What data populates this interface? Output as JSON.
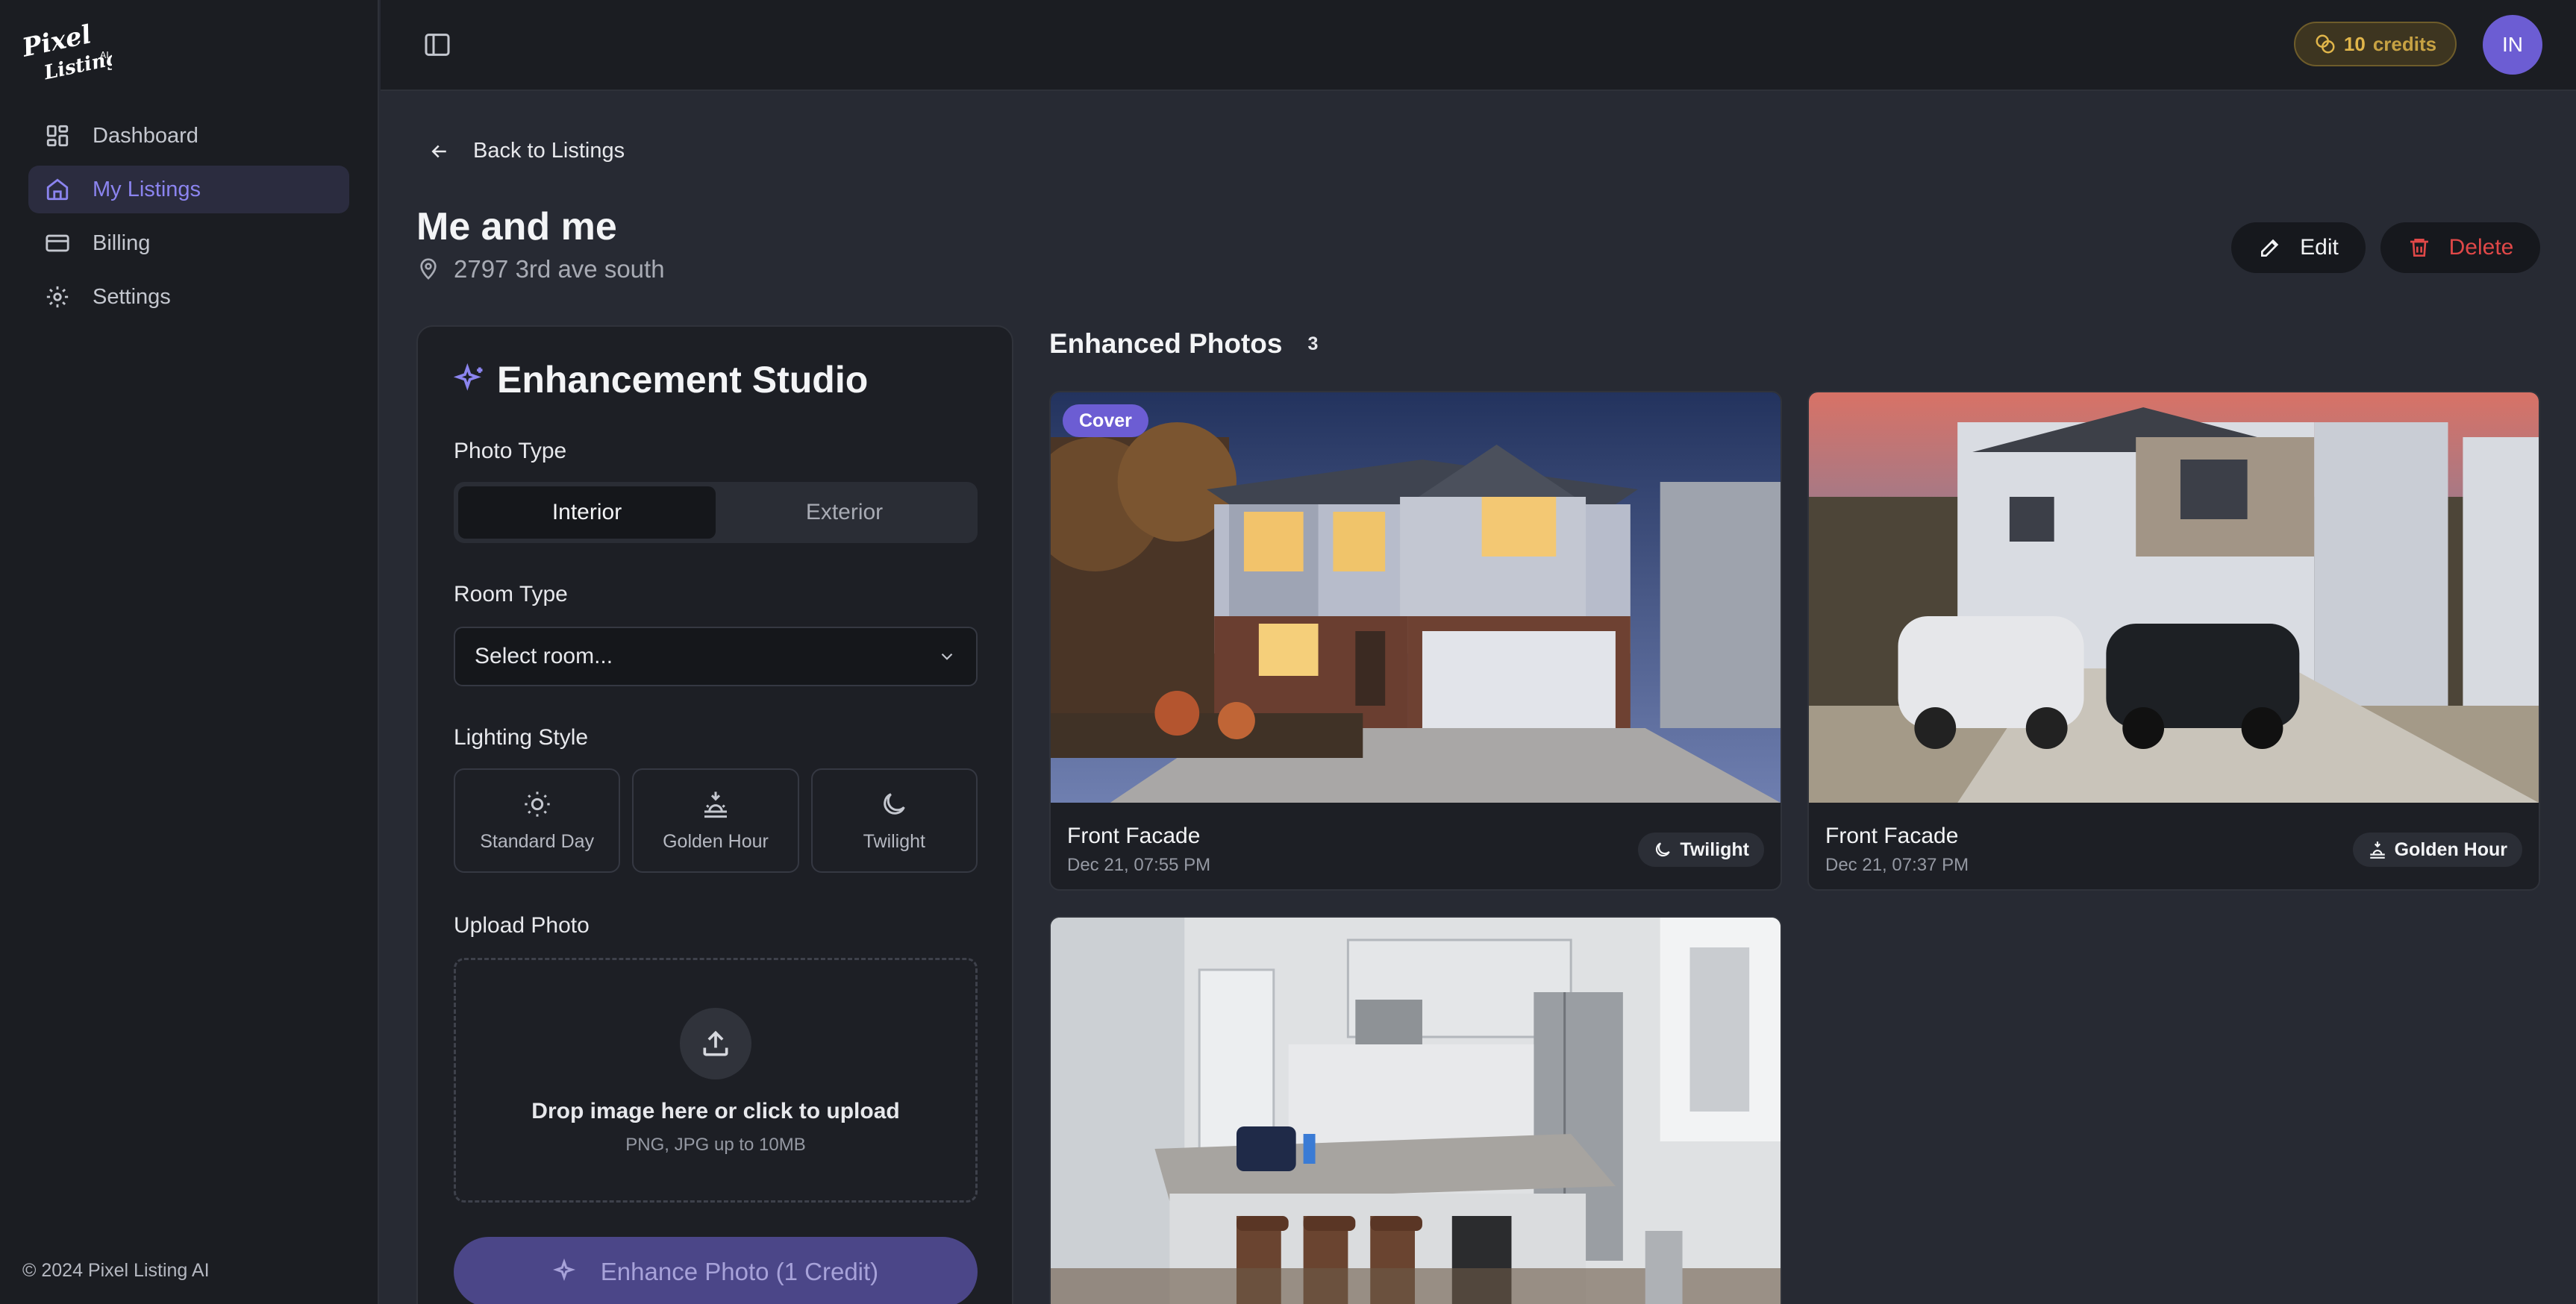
{
  "app": {
    "logo_text": "Pixel Listing AI",
    "copyright": "© 2024 Pixel Listing AI"
  },
  "sidebar": {
    "items": [
      {
        "label": "Dashboard",
        "icon": "dashboard-icon",
        "active": false
      },
      {
        "label": "My Listings",
        "icon": "home-icon",
        "active": true
      },
      {
        "label": "Billing",
        "icon": "credit-card-icon",
        "active": false
      },
      {
        "label": "Settings",
        "icon": "gear-icon",
        "active": false
      }
    ]
  },
  "header": {
    "credits_count": "10",
    "credits_label": "credits",
    "avatar_initials": "IN"
  },
  "listing": {
    "back_label": "Back to Listings",
    "title": "Me and me",
    "address": "2797 3rd ave south",
    "edit_label": "Edit",
    "delete_label": "Delete"
  },
  "studio": {
    "title": "Enhancement Studio",
    "photo_type_label": "Photo Type",
    "photo_types": [
      "Interior",
      "Exterior"
    ],
    "selected_photo_type": "Interior",
    "room_type_label": "Room Type",
    "room_select_value": "Select room...",
    "lighting_label": "Lighting Style",
    "lighting_options": [
      "Standard Day",
      "Golden Hour",
      "Twilight"
    ],
    "upload_label": "Upload Photo",
    "upload_main": "Drop image here or click to upload",
    "upload_sub": "PNG, JPG up to 10MB",
    "enhance_button": "Enhance Photo (1 Credit)"
  },
  "gallery": {
    "title": "Enhanced Photos",
    "count": "3",
    "photos": [
      {
        "badge": "Cover",
        "title": "Front Facade",
        "date": "Dec 21, 07:55 PM",
        "tag": "Twilight"
      },
      {
        "title": "Front Facade",
        "date": "Dec 21, 07:37 PM",
        "tag": "Golden Hour"
      },
      {
        "title": "",
        "date": "",
        "tag": ""
      }
    ]
  },
  "colors": {
    "accent": "#6c5dd3",
    "danger": "#e04848",
    "credits": "#e0b54a"
  }
}
